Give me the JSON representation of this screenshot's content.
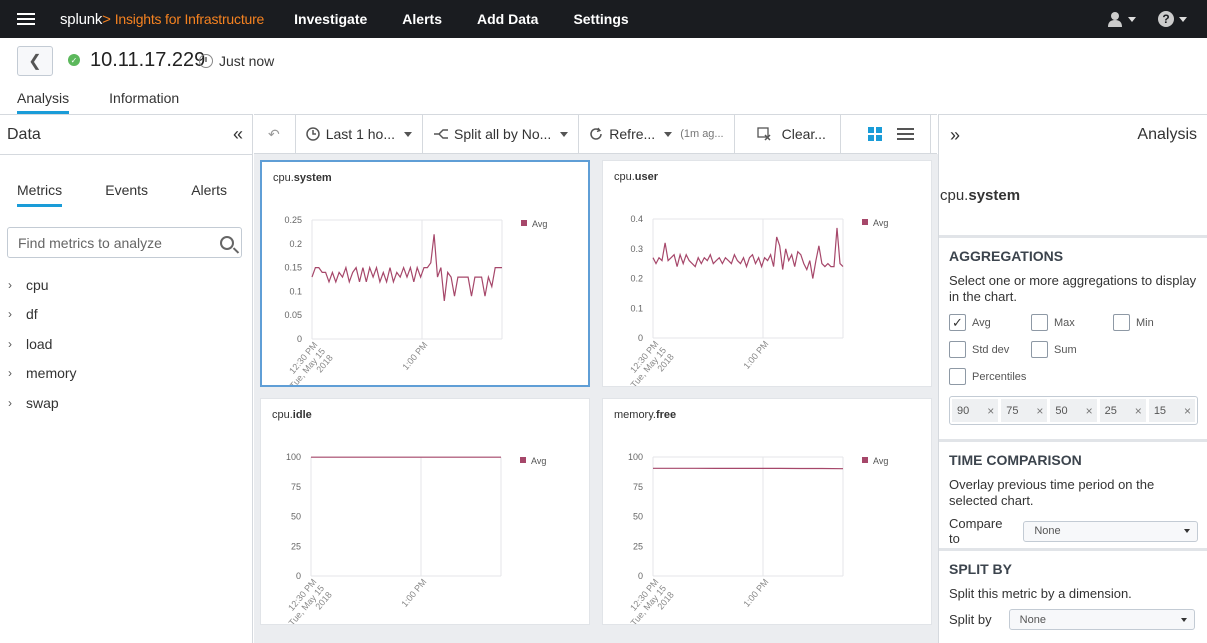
{
  "topnav": {
    "brand": "splunk",
    "brand_sep": ">",
    "app_name": "Insights for Infrastructure",
    "items": [
      "Investigate",
      "Alerts",
      "Add Data",
      "Settings"
    ],
    "help_glyph": "?"
  },
  "header": {
    "host": "10.11.17.229",
    "time": "Just now",
    "back_glyph": "❮",
    "tabs": [
      {
        "label": "Analysis",
        "active": true
      },
      {
        "label": "Information",
        "active": false
      }
    ]
  },
  "data_panel": {
    "title": "Data",
    "collapse_glyph": "«",
    "tabs": [
      "Metrics",
      "Events",
      "Alerts"
    ],
    "search_placeholder": "Find metrics to analyze",
    "tree": [
      "cpu",
      "df",
      "load",
      "memory",
      "swap"
    ]
  },
  "toolbar": {
    "time_range": "Last 1 ho...",
    "split": "Split all by No...",
    "refresh": "Refre...",
    "refresh_age": "(1m ag...",
    "clear": "Clear..."
  },
  "charts": [
    {
      "prefix": "cpu.",
      "metric": "system",
      "selected": true,
      "legend": "Avg"
    },
    {
      "prefix": "cpu.",
      "metric": "user",
      "selected": false,
      "legend": "Avg"
    },
    {
      "prefix": "cpu.",
      "metric": "idle",
      "selected": false,
      "legend": "Avg"
    },
    {
      "prefix": "memory.",
      "metric": "free",
      "selected": false,
      "legend": "Avg"
    }
  ],
  "chart_data": [
    {
      "type": "line",
      "title": "cpu.system",
      "series": [
        {
          "name": "Avg",
          "values": [
            0.13,
            0.15,
            0.15,
            0.14,
            0.14,
            0.12,
            0.14,
            0.12,
            0.14,
            0.13,
            0.15,
            0.12,
            0.14,
            0.15,
            0.12,
            0.15,
            0.12,
            0.15,
            0.13,
            0.15,
            0.12,
            0.14,
            0.12,
            0.15,
            0.12,
            0.14,
            0.13,
            0.15,
            0.13,
            0.15,
            0.12,
            0.15,
            0.13,
            0.15,
            0.15,
            0.16,
            0.22,
            0.13,
            0.15,
            0.08,
            0.14,
            0.13,
            0.09,
            0.13,
            0.13,
            0.13,
            0.13,
            0.09,
            0.13,
            0.13,
            0.13,
            0.09,
            0.13,
            0.11,
            0.15,
            0.15,
            0.15
          ]
        }
      ],
      "x_ticks": [
        "12:30 PM Tue, May 15 2018",
        "1:00 PM"
      ],
      "y_ticks": [
        "0.25",
        "0.2",
        "0.15",
        "0.1",
        "0.05",
        "0"
      ],
      "ylim": [
        0,
        0.25
      ],
      "legend_position": "top-right"
    },
    {
      "type": "line",
      "title": "cpu.user",
      "series": [
        {
          "name": "Avg",
          "values": [
            0.27,
            0.25,
            0.27,
            0.26,
            0.32,
            0.26,
            0.27,
            0.28,
            0.24,
            0.28,
            0.25,
            0.28,
            0.26,
            0.25,
            0.24,
            0.27,
            0.25,
            0.27,
            0.26,
            0.28,
            0.25,
            0.26,
            0.27,
            0.25,
            0.27,
            0.26,
            0.25,
            0.28,
            0.26,
            0.25,
            0.27,
            0.24,
            0.27,
            0.28,
            0.25,
            0.27,
            0.24,
            0.27,
            0.26,
            0.28,
            0.24,
            0.34,
            0.31,
            0.23,
            0.3,
            0.26,
            0.28,
            0.24,
            0.29,
            0.28,
            0.25,
            0.23,
            0.26,
            0.2,
            0.26,
            0.31,
            0.25,
            0.24,
            0.25,
            0.24,
            0.24,
            0.37,
            0.25,
            0.24
          ]
        }
      ],
      "x_ticks": [
        "12:30 PM Tue, May 15 2018",
        "1:00 PM"
      ],
      "y_ticks": [
        "0.4",
        "0.3",
        "0.2",
        "0.1",
        "0"
      ],
      "ylim": [
        0,
        0.4
      ],
      "legend_position": "top-right"
    },
    {
      "type": "line",
      "title": "cpu.idle",
      "series": [
        {
          "name": "Avg",
          "values": [
            99.8,
            99.8,
            99.8,
            99.8,
            99.8,
            99.8,
            99.8,
            99.8,
            99.8,
            99.8
          ]
        }
      ],
      "x_ticks": [
        "12:30 PM Tue, May 15 2018",
        "1:00 PM"
      ],
      "y_ticks": [
        "100",
        "75",
        "50",
        "25",
        "0"
      ],
      "ylim": [
        0,
        100
      ],
      "legend_position": "top-right"
    },
    {
      "type": "line",
      "title": "memory.free",
      "series": [
        {
          "name": "Avg",
          "values": [
            90.5,
            90.5,
            90.5,
            90.4,
            90.4,
            90.4,
            90.4,
            90.3,
            90.3,
            90.2
          ]
        }
      ],
      "x_ticks": [
        "12:30 PM Tue, May 15 2018",
        "1:00 PM"
      ],
      "y_ticks": [
        "100",
        "75",
        "50",
        "25",
        "0"
      ],
      "ylim": [
        0,
        100
      ],
      "legend_position": "top-right"
    }
  ],
  "analysis_panel": {
    "title": "Analysis",
    "expand_glyph": "»",
    "metric_prefix": "cpu.",
    "metric_name": "system",
    "aggregations": {
      "heading": "AGGREGATIONS",
      "desc": "Select one or more aggregations to display in the chart.",
      "options": [
        {
          "label": "Avg",
          "checked": true
        },
        {
          "label": "Max",
          "checked": false
        },
        {
          "label": "Min",
          "checked": false
        },
        {
          "label": "Std dev",
          "checked": false
        },
        {
          "label": "Sum",
          "checked": false
        },
        {
          "label": "Percentiles",
          "checked": false
        }
      ],
      "percentiles": [
        "90",
        "75",
        "50",
        "25",
        "15"
      ]
    },
    "time_comparison": {
      "heading": "TIME COMPARISON",
      "desc": "Overlay previous time period on the selected chart.",
      "label": "Compare to",
      "value": "None"
    },
    "split_by": {
      "heading": "SPLIT BY",
      "desc": "Split this metric by a dimension.",
      "label": "Split by",
      "value": "None"
    }
  },
  "colors": {
    "series": "#a6476a",
    "accent": "#1a9cd8",
    "selected_border": "#5f9ed6"
  }
}
